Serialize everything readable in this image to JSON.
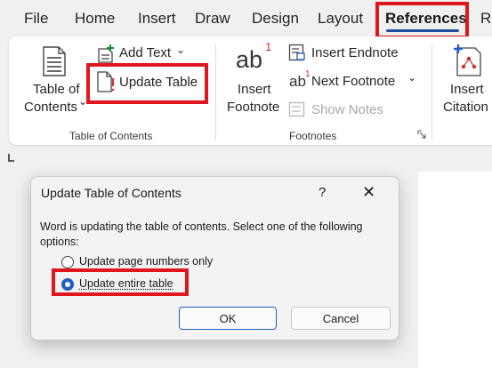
{
  "tabs": [
    "File",
    "Home",
    "Insert",
    "Draw",
    "Design",
    "Layout",
    "References",
    "Re"
  ],
  "active_tab": "References",
  "ribbon": {
    "toc_button": {
      "line1": "Table of",
      "line2": "Contents",
      "chevron": "⌄"
    },
    "add_text": {
      "label": "Add Text",
      "chevron": "⌄"
    },
    "update_table": {
      "label": "Update Table"
    },
    "toc_group_label": "Table of Contents",
    "insert_footnote": {
      "glyph": "ab",
      "sup": "1",
      "line1": "Insert",
      "line2": "Footnote"
    },
    "insert_endnote": {
      "label": "Insert Endnote"
    },
    "next_footnote": {
      "glyph": "ab",
      "sup": "1",
      "label": "Next Footnote",
      "chevron": "⌄"
    },
    "show_notes": {
      "label": "Show Notes"
    },
    "footnotes_group_label": "Footnotes",
    "insert_citation": {
      "line1": "Insert",
      "line2": "Citation"
    }
  },
  "dialog": {
    "title": "Update Table of Contents",
    "help": "?",
    "close": "✕",
    "message": "Word is updating the table of contents.  Select one of the following options:",
    "options": [
      "Update page numbers only",
      "Update entire table"
    ],
    "selected_option": "Update entire table",
    "ok_label": "OK",
    "cancel_label": "Cancel"
  },
  "colors": {
    "highlight": "#e0161f",
    "accent": "#1f5fbf",
    "tab_underline": "#1f4e9c"
  }
}
